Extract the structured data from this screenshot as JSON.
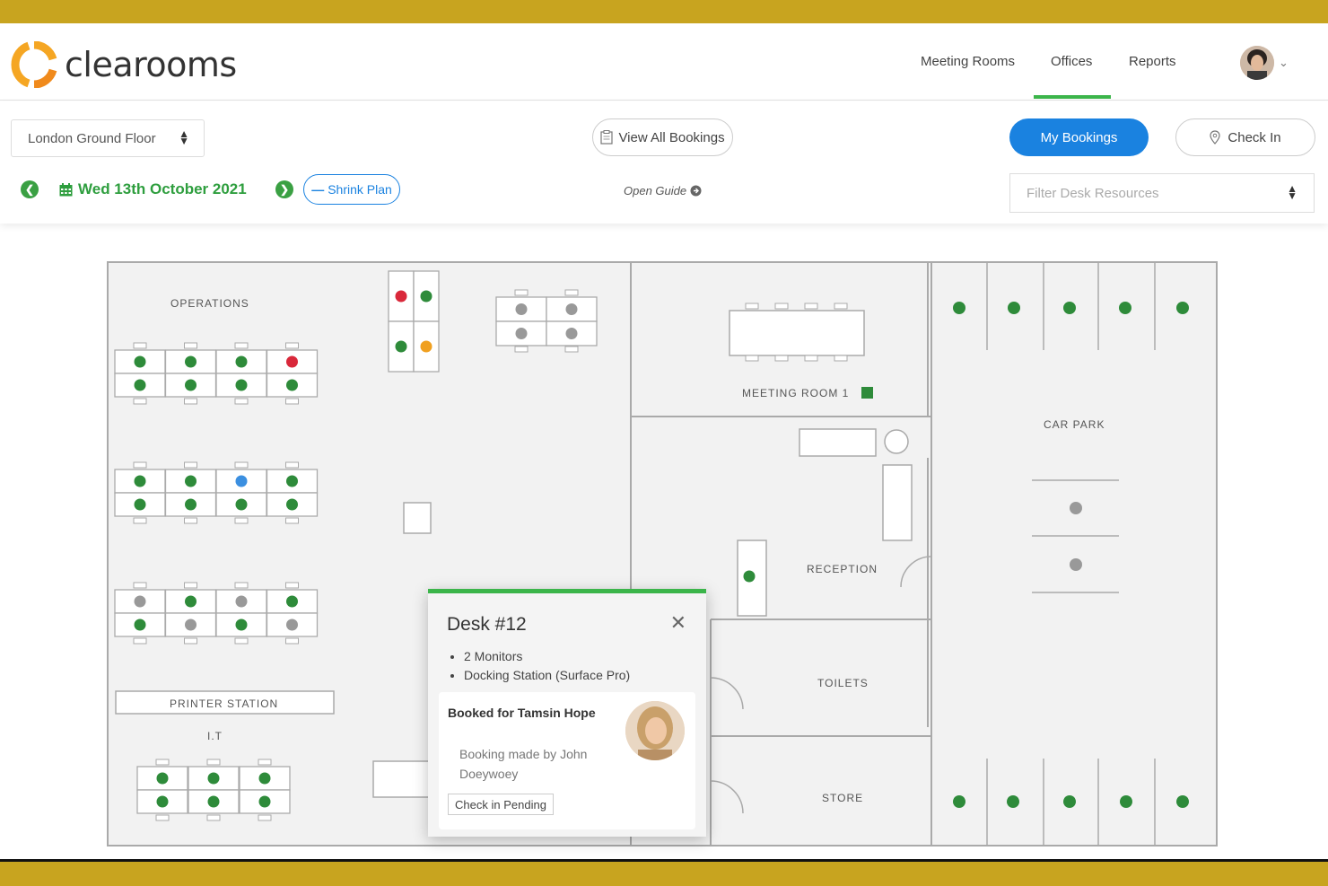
{
  "app": {
    "name": "clearooms"
  },
  "header": {
    "nav": [
      {
        "label": "Meeting Rooms",
        "active": false
      },
      {
        "label": "Offices",
        "active": true
      },
      {
        "label": "Reports",
        "active": false
      }
    ],
    "accent_color": "#3bb54a"
  },
  "toolbar": {
    "floor_select": "London Ground Floor",
    "view_all_label": "View All Bookings",
    "my_bookings_label": "My Bookings",
    "check_in_label": "Check In",
    "date": "Wed 13th October 2021",
    "shrink_label": "Shrink Plan",
    "guide_label": "Open Guide",
    "filter_placeholder": "Filter Desk Resources",
    "primary_color": "#1a82e0"
  },
  "plan": {
    "labels": {
      "operations": "OPERATIONS",
      "printer": "PRINTER STATION",
      "it": "I.T",
      "meeting_room": "MEETING ROOM 1",
      "car_park": "CAR PARK",
      "reception": "RECEPTION",
      "toilets": "TOILETS",
      "store": "STORE"
    },
    "status_colors": {
      "available": "#2e8b3a",
      "booked": "#d9283a",
      "pending": "#f0a020",
      "mine": "#3b8fe0",
      "unavailable": "#999999"
    }
  },
  "popup": {
    "title": "Desk #12",
    "features": [
      "2 Monitors",
      "Docking Station (Surface Pro)"
    ],
    "booked_for": "Booked for Tamsin Hope",
    "booked_by": "Booking made by John Doeywoey",
    "status": "Check in Pending"
  }
}
